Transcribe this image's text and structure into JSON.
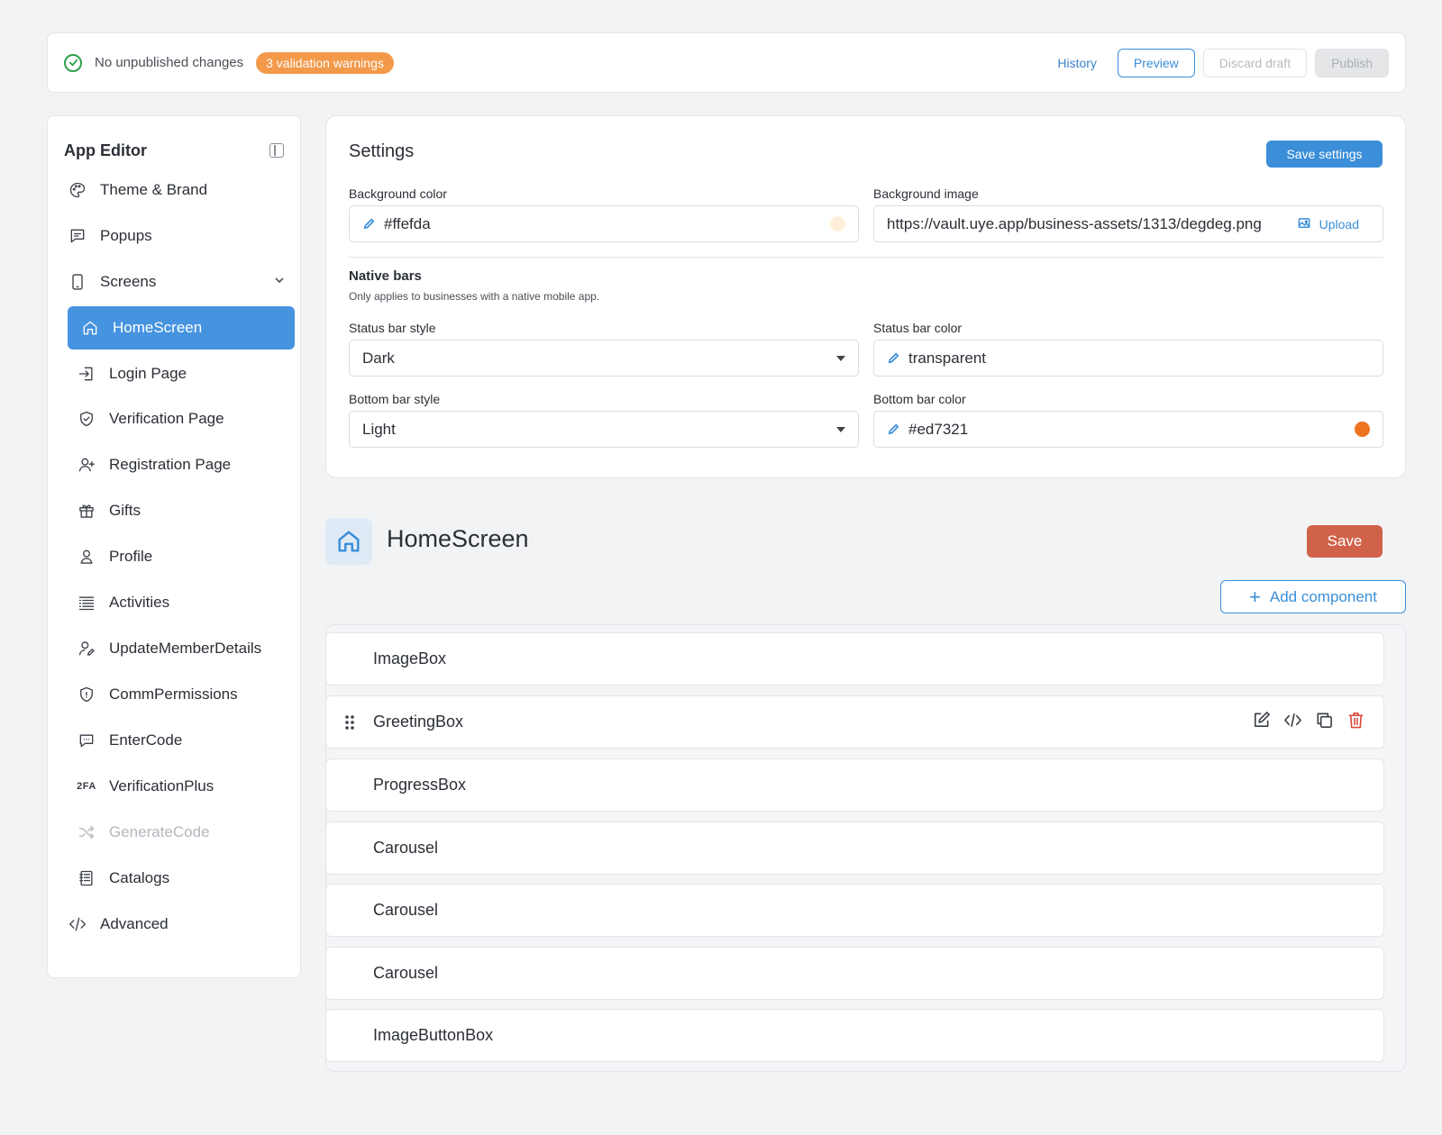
{
  "topbar": {
    "status_text": "No unpublished changes",
    "warning_badge": "3 validation warnings",
    "history_label": "History",
    "preview_label": "Preview",
    "discard_label": "Discard draft",
    "publish_label": "Publish"
  },
  "sidebar": {
    "title": "App Editor",
    "theme_label": "Theme & Brand",
    "popups_label": "Popups",
    "screens_label": "Screens",
    "screens": [
      {
        "label": "HomeScreen",
        "icon": "home-icon",
        "active": true
      },
      {
        "label": "Login Page",
        "icon": "login-icon"
      },
      {
        "label": "Verification Page",
        "icon": "shield-check-icon"
      },
      {
        "label": "Registration Page",
        "icon": "user-plus-icon"
      },
      {
        "label": "Gifts",
        "icon": "gift-icon"
      },
      {
        "label": "Profile",
        "icon": "user-icon"
      },
      {
        "label": "Activities",
        "icon": "list-icon"
      },
      {
        "label": "UpdateMemberDetails",
        "icon": "user-edit-icon"
      },
      {
        "label": "CommPermissions",
        "icon": "shield-icon"
      },
      {
        "label": "EnterCode",
        "icon": "chat-code-icon"
      },
      {
        "label": "VerificationPlus",
        "icon": "2fa-icon",
        "icon_text": "2FA"
      },
      {
        "label": "GenerateCode",
        "icon": "shuffle-icon",
        "disabled": true
      },
      {
        "label": "Catalogs",
        "icon": "catalog-icon"
      }
    ],
    "advanced_label": "Advanced"
  },
  "settings": {
    "title": "Settings",
    "save_label": "Save settings",
    "background_color_label": "Background color",
    "background_color_value": "#ffefda",
    "background_image_label": "Background image",
    "background_image_value": "https://vault.uye.app/business-assets/1313/degdeg.png",
    "upload_label": "Upload",
    "native_bars_title": "Native bars",
    "native_bars_subtitle": "Only applies to businesses with a native mobile app.",
    "status_bar_style_label": "Status bar style",
    "status_bar_style_value": "Dark",
    "status_bar_color_label": "Status bar color",
    "status_bar_color_value": "transparent",
    "bottom_bar_style_label": "Bottom bar style",
    "bottom_bar_style_value": "Light",
    "bottom_bar_color_label": "Bottom bar color",
    "bottom_bar_color_value": "#ed7321"
  },
  "screen": {
    "title": "HomeScreen",
    "save_label": "Save",
    "add_component_label": "Add component",
    "components": [
      "ImageBox",
      "GreetingBox",
      "ProgressBox",
      "Carousel",
      "Carousel",
      "Carousel",
      "ImageButtonBox"
    ]
  },
  "colors": {
    "accent": "#3b8ed8",
    "active_nav": "#4693e0",
    "warning": "#f2994a",
    "save_button": "#d0624a",
    "background_swatch": "#ffefda",
    "bottom_bar_swatch": "#ed7321"
  }
}
